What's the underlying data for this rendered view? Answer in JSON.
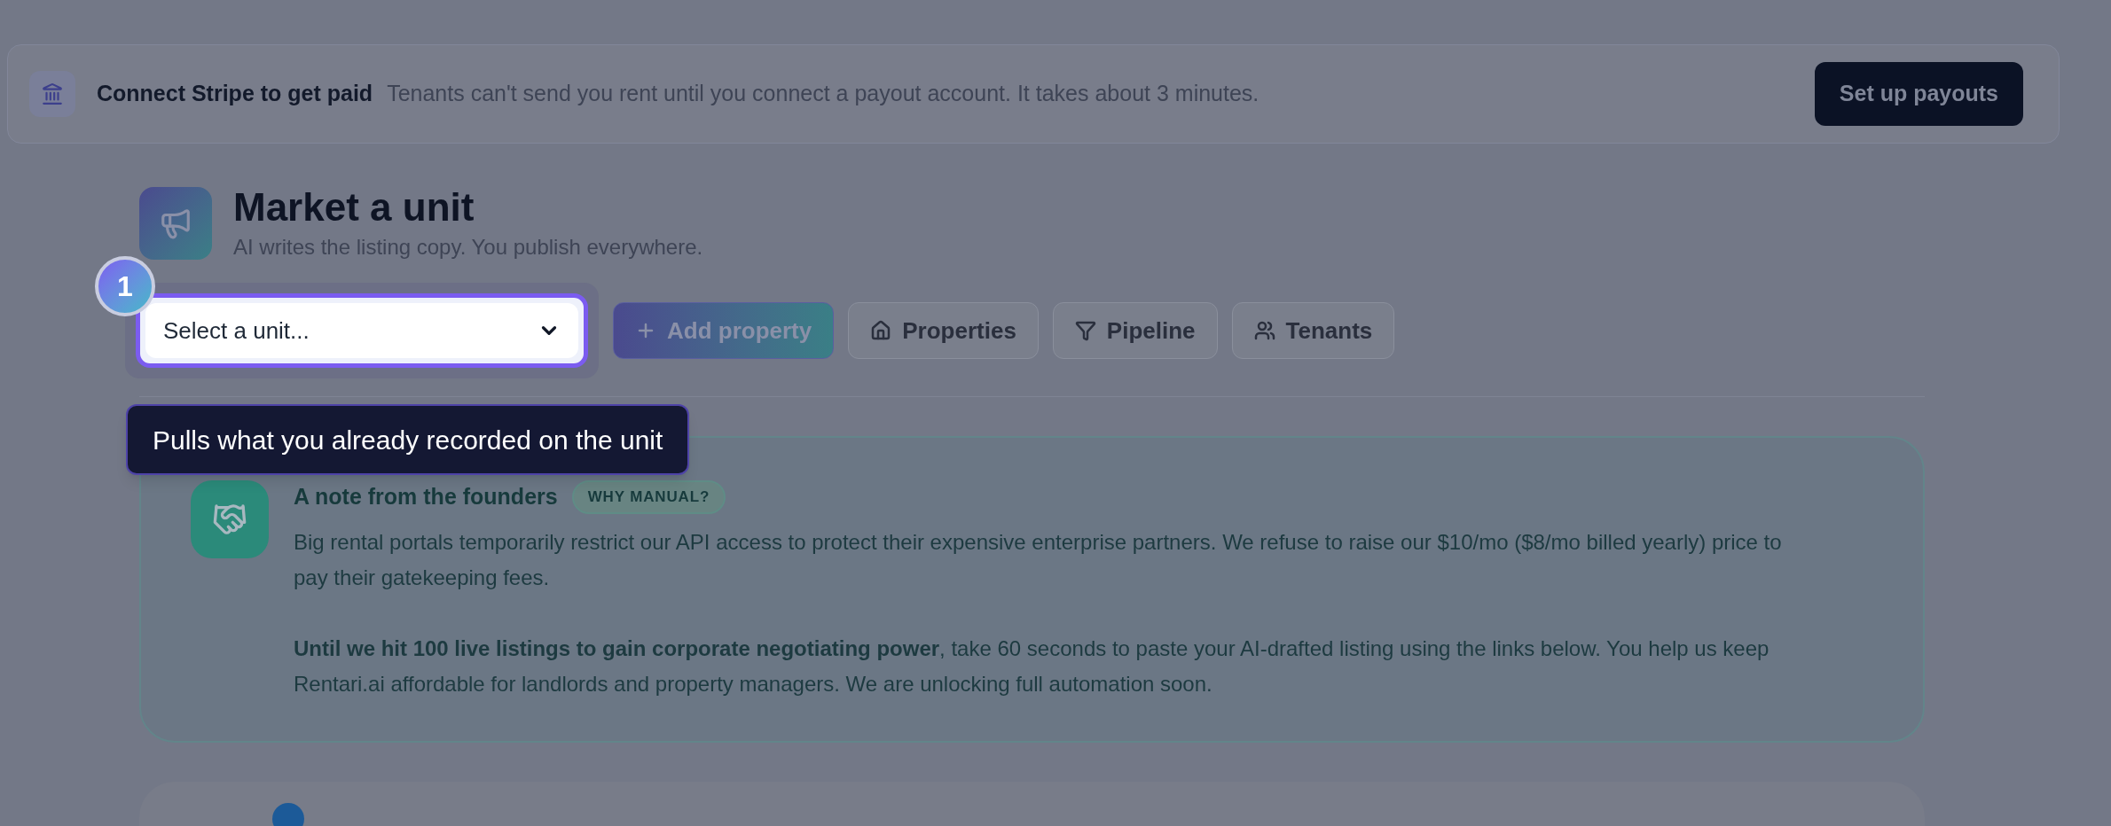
{
  "banner": {
    "title": "Connect Stripe to get paid",
    "text": "Tenants can't send you rent until you connect a payout account. It takes about 3 minutes.",
    "button": "Set up payouts"
  },
  "header": {
    "title": "Market a unit",
    "subtitle": "AI writes the listing copy. You publish everywhere."
  },
  "tour": {
    "step": "1",
    "tooltip": "Pulls what you already recorded on the unit"
  },
  "unit_select": {
    "value": "Select a unit..."
  },
  "toolbar": [
    {
      "label": "Add property",
      "kind": "primary"
    },
    {
      "label": "Properties",
      "kind": "secondary"
    },
    {
      "label": "Pipeline",
      "kind": "secondary"
    },
    {
      "label": "Tenants",
      "kind": "secondary"
    }
  ],
  "note": {
    "title": "A note from the founders",
    "badge": "WHY MANUAL?",
    "paragraphs": [
      "Big rental portals temporarily restrict our API access to protect their expensive enterprise partners. We refuse to raise our $10/mo ($8/mo billed yearly) price to pay their gatekeeping fees.",
      "**Until we hit 100 live listings to gain corporate negotiating power**, take 60 seconds to paste your AI-drafted listing using the links below. You help us keep Rentari.ai affordable for landlords and property managers. We are unlocking full automation soon."
    ]
  }
}
